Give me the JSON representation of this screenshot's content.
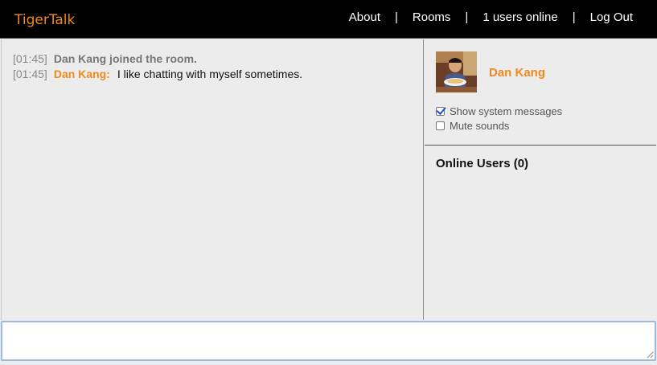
{
  "header": {
    "brand": "TigerTalk",
    "nav": [
      {
        "label": "About"
      },
      {
        "label": "Rooms"
      },
      {
        "label": "1 users online"
      },
      {
        "label": "Log Out"
      }
    ],
    "separator": "|"
  },
  "chat": {
    "messages": [
      {
        "time": "[01:45]",
        "type": "system",
        "text": "Dan Kang joined the room."
      },
      {
        "time": "[01:45]",
        "type": "user",
        "author": "Dan Kang:",
        "text": "I like chatting with myself sometimes."
      }
    ]
  },
  "sidebar": {
    "username": "Dan Kang",
    "options": [
      {
        "label": "Show system messages",
        "checked": true
      },
      {
        "label": "Mute sounds",
        "checked": false
      }
    ],
    "online_title": "Online Users (0)"
  },
  "composer": {
    "value": "",
    "placeholder": ""
  },
  "colors": {
    "accent": "#f08a1c",
    "header_bg": "#000000",
    "panel_bg": "#ececec",
    "input_border": "#9bbbe0"
  }
}
